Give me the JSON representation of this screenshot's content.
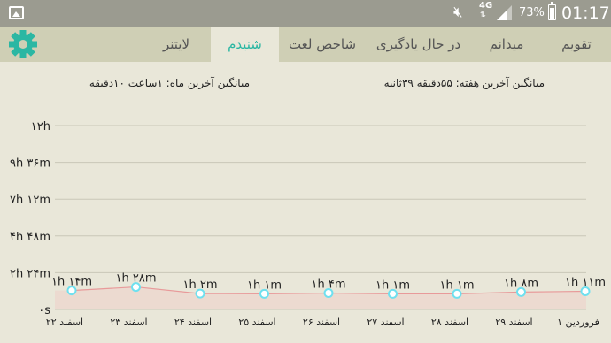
{
  "status_bar": {
    "left_icon": "gallery-icon",
    "mute_icon": "mute-icon",
    "network": "4G",
    "signal_icon": "signal-icon",
    "battery_percent": "73%",
    "battery_level": 0.73,
    "time": "01:17"
  },
  "tabs": [
    {
      "label": "تقویم",
      "active": false
    },
    {
      "label": "میدانم",
      "active": false
    },
    {
      "label": "در حال یادگیری",
      "active": false
    },
    {
      "label": "شاخص لغت",
      "active": false
    },
    {
      "label": "شنیدم",
      "active": true
    },
    {
      "label": "لایتنر",
      "active": false
    }
  ],
  "settings": {
    "icon": "gear-icon",
    "color": "#2bb7a3"
  },
  "summary": {
    "week_average": "میانگین آخرین هفته: ۵۵دقیقه ۳۹ثانیه",
    "month_average": "میانگین آخرین ماه: ۱ساعت ۱۰دقیقه"
  },
  "chart_data": {
    "type": "line",
    "y_unit": "minutes",
    "ylim": [
      0,
      720
    ],
    "y_ticks": [
      {
        "value": 0,
        "label": "۰s"
      },
      {
        "value": 144,
        "label": "۲h ۲۴m"
      },
      {
        "value": 288,
        "label": "۴h ۴۸m"
      },
      {
        "value": 432,
        "label": "۷h ۱۲m"
      },
      {
        "value": 576,
        "label": "۹h ۳۶m"
      },
      {
        "value": 720,
        "label": "۱۲h"
      }
    ],
    "categories": [
      "۲۲ اسفند",
      "۲۳ اسفند",
      "۲۴ اسفند",
      "۲۵ اسفند",
      "۲۶ اسفند",
      "۲۷ اسفند",
      "۲۸ اسفند",
      "۲۹ اسفند",
      "۱ فروردین"
    ],
    "values": [
      74,
      88,
      62,
      61,
      64,
      61,
      61,
      68,
      71
    ],
    "value_labels": [
      "۱h ۱۴m",
      "۱h ۲۸m",
      "۱h ۲m",
      "۱h ۱m",
      "۱h ۴m",
      "۱h ۱m",
      "۱h ۱m",
      "۱h ۸m",
      "۱h ۱۱m"
    ],
    "grid": true,
    "colors": {
      "line": "#e89a9a",
      "area": "#ecd4cc",
      "point": "#6fe0ef",
      "grid": "#c9c7b7"
    }
  }
}
